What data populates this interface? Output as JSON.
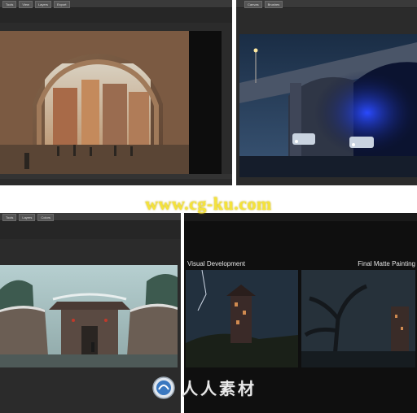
{
  "panel_top_left": {
    "toolbar_buttons": [
      "Tools",
      "View",
      "Layers",
      "Export"
    ]
  },
  "panel_top_right": {
    "toolbar_buttons": [
      "Canvas",
      "Brushes"
    ]
  },
  "panel_bottom_left": {
    "toolbar_buttons": [
      "Tools",
      "Layers",
      "Colors"
    ]
  },
  "panel_bottom_right": {
    "caption_left": "Visual Development",
    "caption_right": "Final Matte Painting"
  },
  "watermark": {
    "url": "www.cg-ku.com",
    "logo_text": "人人素材"
  },
  "colors": {
    "url_yellow": "#f5e33a",
    "panel_bg": "#2b2b2b",
    "toolbar_bg": "#3a3a3a"
  }
}
